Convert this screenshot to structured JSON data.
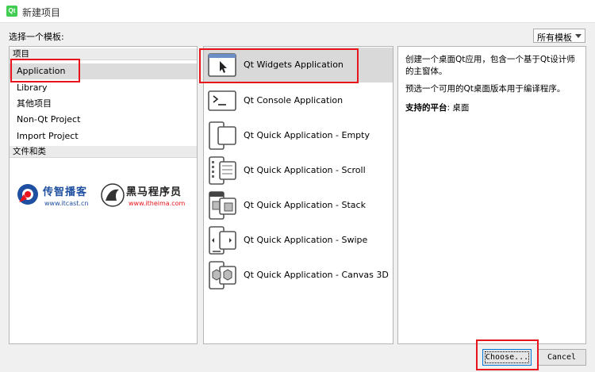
{
  "window": {
    "title": "新建项目",
    "logo_text": "Qt"
  },
  "header": {
    "choose_label": "选择一个模板:",
    "filter": {
      "selected": "所有模板"
    }
  },
  "categories": {
    "project_header": "项目",
    "project_items": [
      "Application",
      "Library",
      "其他项目",
      "Non-Qt Project",
      "Import Project"
    ],
    "files_header": "文件和类"
  },
  "branding": {
    "logo1_name": "传智播客",
    "logo1_url": "www.itcast.cn",
    "logo2_name": "黑马程序员",
    "logo2_url": "www.itheima.com"
  },
  "templates": [
    {
      "label": "Qt Widgets Application",
      "icon": "widgets-app-icon"
    },
    {
      "label": "Qt Console Application",
      "icon": "console-app-icon"
    },
    {
      "label": "Qt Quick Application - Empty",
      "icon": "quick-empty-icon"
    },
    {
      "label": "Qt Quick Application - Scroll",
      "icon": "quick-scroll-icon"
    },
    {
      "label": "Qt Quick Application - Stack",
      "icon": "quick-stack-icon"
    },
    {
      "label": "Qt Quick Application - Swipe",
      "icon": "quick-swipe-icon"
    },
    {
      "label": "Qt Quick Application - Canvas 3D",
      "icon": "quick-canvas3d-icon"
    }
  ],
  "description": {
    "line1": "创建一个桌面Qt应用，包含一个基于Qt设计师的主窗体。",
    "line2": "预选一个可用的Qt桌面版本用于编译程序。",
    "platform_label": "支持的平台",
    "platform_value": ": 桌面"
  },
  "buttons": {
    "choose": "Choose...",
    "cancel": "Cancel"
  },
  "colors": {
    "highlight_box": "#e8141c",
    "selection_bg": "#d9d9d9",
    "qt_green": "#41cd52"
  }
}
